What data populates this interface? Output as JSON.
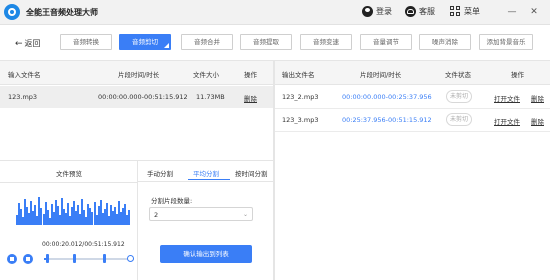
{
  "app": {
    "title": "全能王音频处理大师"
  },
  "titlebar": {
    "login": "登录",
    "service": "客服",
    "menu": "菜单",
    "minimize": "—",
    "close": "✕"
  },
  "toolbar": {
    "back": "返回",
    "buttons": [
      "音频转换",
      "音频剪切",
      "音频合并",
      "音频提取",
      "音频变速",
      "音量调节",
      "噪声消除",
      "添加背景音乐"
    ],
    "active_index": 1
  },
  "input_table": {
    "headers": [
      "输入文件名",
      "片段时间/时长",
      "文件大小",
      "操作"
    ],
    "rows": [
      {
        "name": "123.mp3",
        "time": "00:00:00.000-00:51:15.912",
        "size": "11.73MB",
        "action": "删除"
      }
    ]
  },
  "output_table": {
    "headers": [
      "输出文件名",
      "片段时间/时长",
      "文件状态",
      "操作"
    ],
    "rows": [
      {
        "name": "123_2.mp3",
        "time": "00:00:00.000-00:25:37.956",
        "status": "未剪切",
        "open": "打开文件",
        "delete": "删除"
      },
      {
        "name": "123_3.mp3",
        "time": "00:25:37.956-00:51:15.912",
        "status": "未剪切",
        "open": "打开文件",
        "delete": "删除"
      }
    ]
  },
  "preview": {
    "title": "文件预览",
    "time_readout": "00:00:20.012/00:51:15.912",
    "playback_progress": 0.0065
  },
  "split": {
    "tabs": [
      "手动分割",
      "平均分割",
      "按时间分割"
    ],
    "active_tab": 1,
    "segment_label": "分割片段数量:",
    "segment_value": "2",
    "confirm": "确认输出到列表"
  },
  "colors": {
    "accent": "#3a7ef6"
  }
}
